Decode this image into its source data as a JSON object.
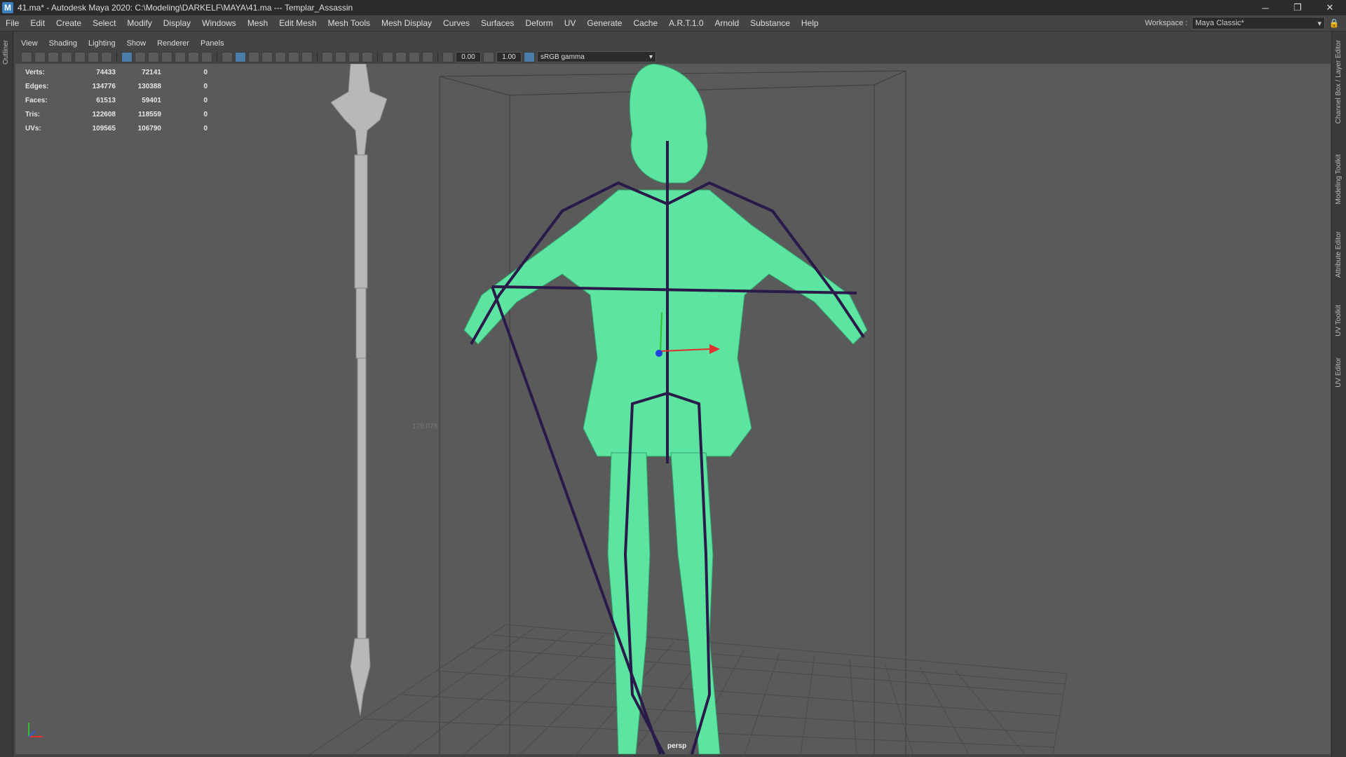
{
  "window": {
    "title": "41.ma* - Autodesk Maya 2020: C:\\Modeling\\DARKELF\\MAYA\\41.ma  ---  Templar_Assassin",
    "controls": [
      "─",
      "❐",
      "✕"
    ]
  },
  "menubar": {
    "items": [
      "File",
      "Edit",
      "Create",
      "Select",
      "Modify",
      "Display",
      "Windows",
      "Mesh",
      "Edit Mesh",
      "Mesh Tools",
      "Mesh Display",
      "Curves",
      "Surfaces",
      "Deform",
      "UV",
      "Generate",
      "Cache",
      "A.R.T.1.0",
      "Arnold",
      "Substance",
      "Help"
    ],
    "workspace_label": "Workspace :",
    "workspace_value": "Maya Classic*"
  },
  "left_strip": {
    "outliner": "Outliner"
  },
  "right_strip": {
    "tabs": [
      "Channel Box / Layer Editor",
      "Modeling Toolkit",
      "Attribute Editor",
      "UV Toolkit",
      "UV Editor"
    ]
  },
  "panel_menu": [
    "View",
    "Shading",
    "Lighting",
    "Show",
    "Renderer",
    "Panels"
  ],
  "toolbar": {
    "field1": "0.00",
    "field2": "1.00",
    "color_space": "sRGB gamma"
  },
  "hud": {
    "rows": [
      {
        "label": "Verts:",
        "v1": "74433",
        "v2": "72141",
        "v3": "0"
      },
      {
        "label": "Edges:",
        "v1": "134776",
        "v2": "130388",
        "v3": "0"
      },
      {
        "label": "Faces:",
        "v1": "61513",
        "v2": "59401",
        "v3": "0"
      },
      {
        "label": "Tris:",
        "v1": "122608",
        "v2": "118559",
        "v3": "0"
      },
      {
        "label": "UVs:",
        "v1": "109565",
        "v2": "106790",
        "v3": "0"
      }
    ]
  },
  "viewport": {
    "camera": "persp",
    "dimension_label": "179.078",
    "mesh_color": "#5ef0a8",
    "skeleton_color": "#2a1a4a",
    "grid_color": "#4a4a4a"
  }
}
